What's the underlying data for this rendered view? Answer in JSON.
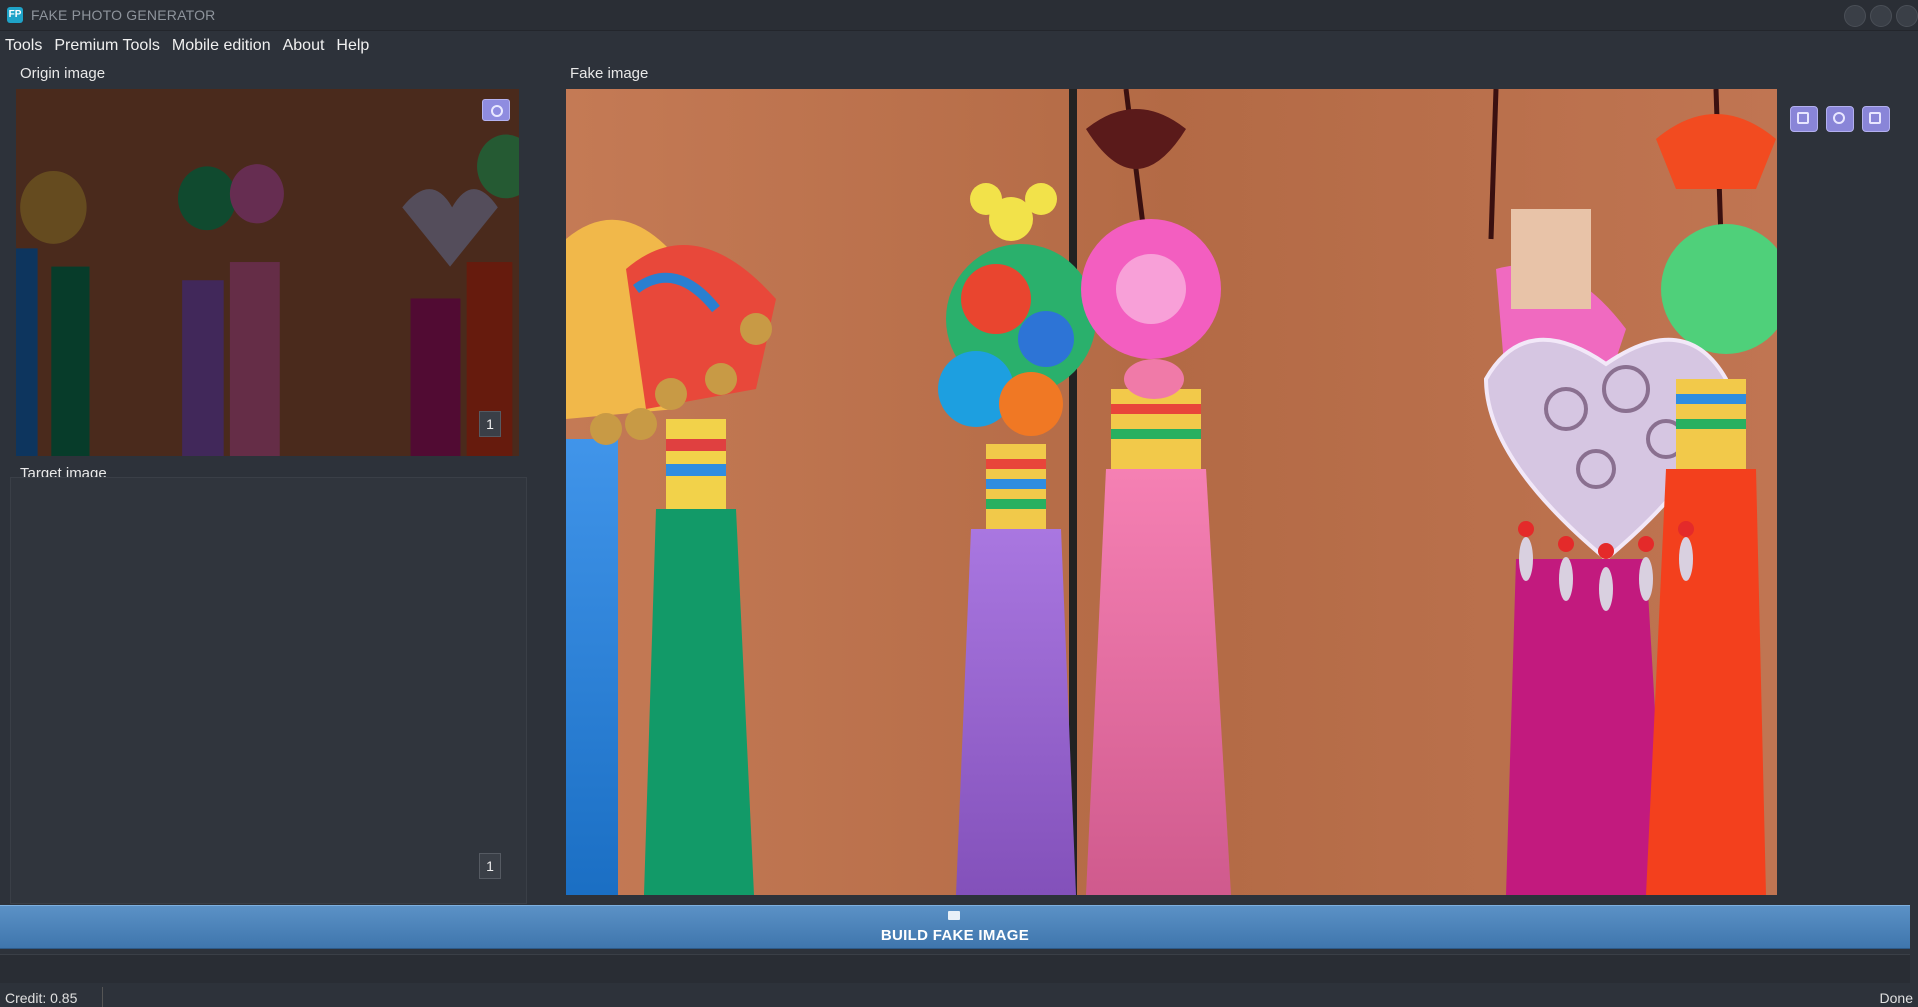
{
  "window": {
    "title": "FAKE PHOTO GENERATOR",
    "icon": "app-logo-icon"
  },
  "menu": {
    "items": [
      "Tools",
      "Premium Tools",
      "Mobile edition",
      "About",
      "Help"
    ]
  },
  "origin": {
    "label": "Origin image",
    "count": "1",
    "camera_icon": "camera-icon"
  },
  "target": {
    "label": "Target image",
    "count": "1"
  },
  "fake": {
    "label": "Fake  image",
    "tools": [
      "save-icon",
      "share-icon",
      "export-icon"
    ]
  },
  "build": {
    "label": "BUILD FAKE IMAGE",
    "icon": "image-icon"
  },
  "status": {
    "left": "Credit: 0.85",
    "right": "Done"
  },
  "colors": {
    "background": "#2d323a",
    "build_button": "#4d85bc",
    "tool_buttons": "#8985d8"
  }
}
